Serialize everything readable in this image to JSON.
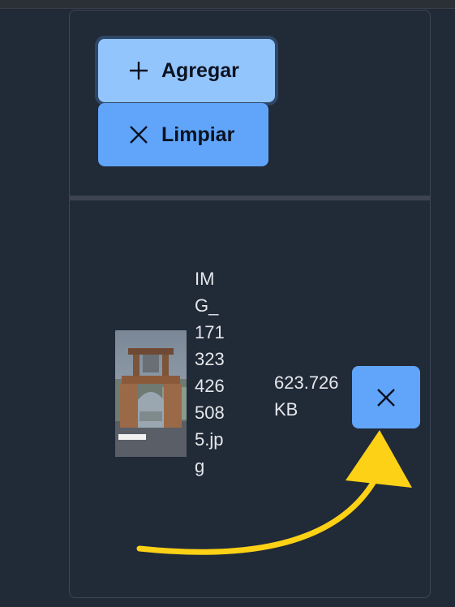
{
  "toolbar": {
    "add_label": "Agregar",
    "clear_label": "Limpiar"
  },
  "file": {
    "name": "IMG_1713234265085.jpg",
    "size": "623.726 KB"
  },
  "icons": {
    "add": "plus-icon",
    "clear": "close-icon",
    "remove": "close-icon"
  },
  "colors": {
    "background": "#212a37",
    "add_button": "#93c5fd",
    "clear_button": "#60a5fa",
    "remove_button": "#60a5fa",
    "annotation_arrow": "#fcd116"
  }
}
